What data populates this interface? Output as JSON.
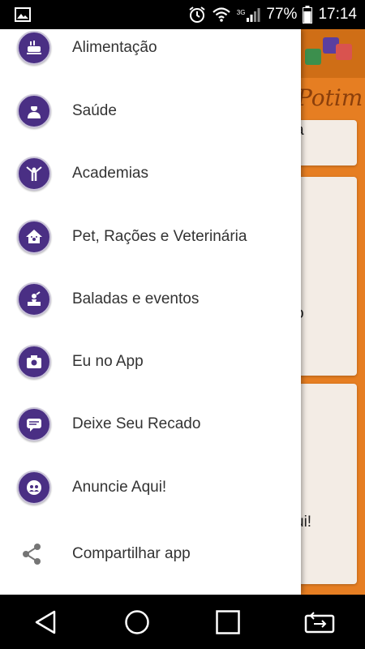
{
  "status_bar": {
    "battery": "77%",
    "time": "17:14",
    "network": "3G"
  },
  "background_app": {
    "brand_text": "Potim",
    "card1_text": "a",
    "card2_text": "o",
    "card3_text": "ui!"
  },
  "drawer": {
    "items": [
      {
        "label": "Alimentação",
        "icon": "food-icon"
      },
      {
        "label": "Saúde",
        "icon": "doctor-icon"
      },
      {
        "label": "Academias",
        "icon": "fitness-icon"
      },
      {
        "label": "Pet, Rações e Veterinária",
        "icon": "pet-icon"
      },
      {
        "label": "Baladas e eventos",
        "icon": "party-icon"
      },
      {
        "label": "Eu no App",
        "icon": "camera-icon"
      },
      {
        "label": "Deixe Seu Recado",
        "icon": "message-icon"
      },
      {
        "label": "Anuncie Aqui!",
        "icon": "advertise-icon"
      },
      {
        "label": "Compartilhar app",
        "icon": "share-icon"
      }
    ]
  },
  "colors": {
    "accent_orange": "#e67e22",
    "icon_purple": "#4a2f84",
    "drawer_bg": "#ffffff"
  }
}
